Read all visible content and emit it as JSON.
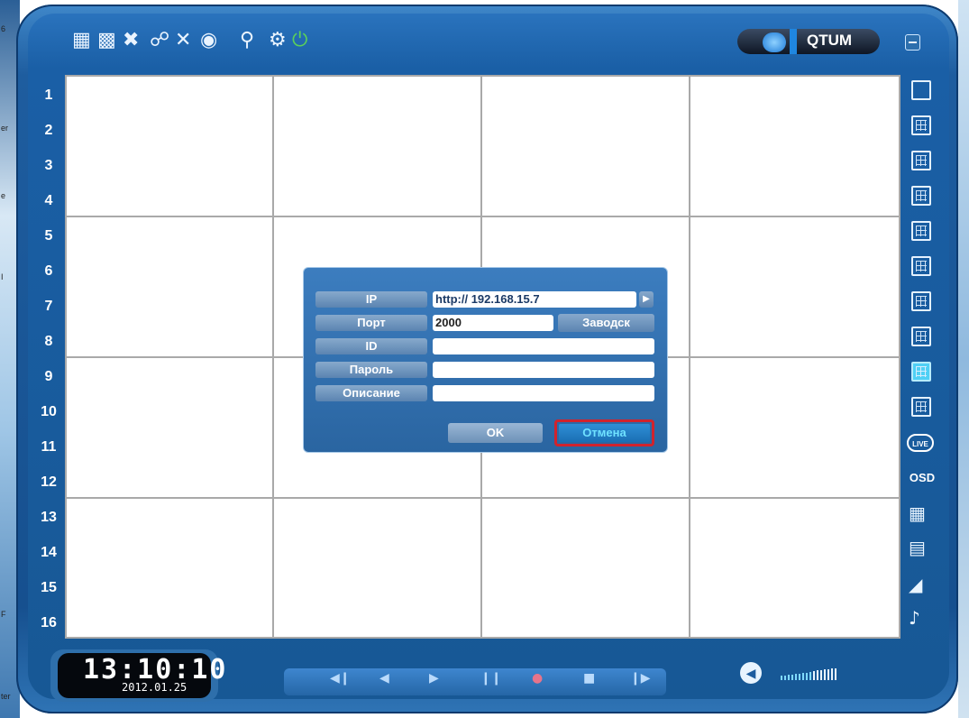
{
  "window": {
    "brand": "QTUM"
  },
  "desktop": {
    "edge_texts": [
      "6",
      "er",
      "e",
      "I",
      "F",
      "ter"
    ]
  },
  "toolbar": {
    "icons": [
      "channel-settings-icon",
      "network-settings-icon",
      "tools-icon",
      "search-icon",
      "config-icon",
      "ptz-icon",
      "zoom-icon",
      "settings-gear-icon",
      "power-icon"
    ]
  },
  "channels": [
    "1",
    "2",
    "3",
    "4",
    "5",
    "6",
    "7",
    "8",
    "9",
    "10",
    "11",
    "12",
    "13",
    "14",
    "15",
    "16"
  ],
  "layouts": {
    "buttons": [
      "layout-1",
      "layout-4",
      "layout-6",
      "layout-8",
      "layout-9a",
      "layout-9",
      "layout-10",
      "layout-13",
      "layout-16",
      "layout-fullscreen"
    ],
    "active": "layout-16",
    "live_label": "LIVE",
    "osd_label": "OSD"
  },
  "dialog": {
    "ip_label": "IP",
    "ip_value": "http:// 192.168.15.7",
    "port_label": "Порт",
    "port_value": "2000",
    "factory_button": "Заводск",
    "id_label": "ID",
    "id_value": "",
    "password_label": "Пароль",
    "password_value": "",
    "description_label": "Описание",
    "description_value": "",
    "ok_button": "OK",
    "cancel_button": "Отмена"
  },
  "status": {
    "time": "13:10:10",
    "date": "2012.01.25"
  },
  "playback": {
    "buttons": [
      "skip-back",
      "rewind",
      "play",
      "pause",
      "record",
      "stop",
      "skip-forward"
    ]
  },
  "colors": {
    "frame": "#1a5fa6",
    "active_layout": "#4fd0f5",
    "cancel_highlight": "#d1232d",
    "cancel_text": "#6fe1ff"
  }
}
